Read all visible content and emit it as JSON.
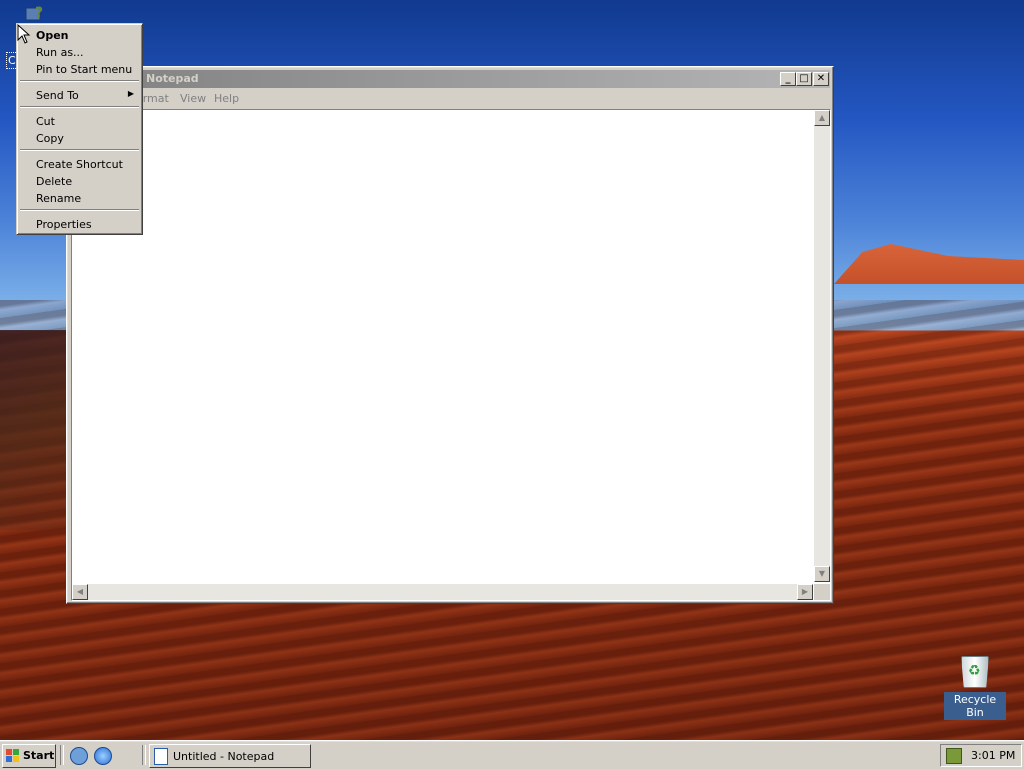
{
  "desktop": {
    "computer_label": "Co",
    "recycle_bin_label": "Recycle Bin"
  },
  "notepad": {
    "title": "Notepad",
    "menu": [
      "ormat",
      "View",
      "Help"
    ],
    "buttons": {
      "minimize": "_",
      "maximize": "□",
      "close": "✕"
    }
  },
  "context_menu": {
    "items": [
      {
        "label": "Open",
        "bold": true
      },
      {
        "label": "Run as..."
      },
      {
        "label": "Pin to Start menu"
      },
      {
        "separator": true
      },
      {
        "label": "Send To",
        "submenu": true
      },
      {
        "separator": true
      },
      {
        "label": "Cut"
      },
      {
        "label": "Copy"
      },
      {
        "separator": true
      },
      {
        "label": "Create Shortcut"
      },
      {
        "label": "Delete"
      },
      {
        "label": "Rename"
      },
      {
        "separator": true
      },
      {
        "label": "Properties"
      }
    ]
  },
  "taskbar": {
    "start_label": "Start",
    "task_label": "Untitled - Notepad",
    "clock": "3:01 PM"
  },
  "icons": {
    "computer": "computer-icon",
    "recycle": "recycle-bin-icon",
    "ie": "internet-explorer-icon",
    "desktop_show": "show-desktop-icon",
    "network": "network-tray-icon"
  }
}
